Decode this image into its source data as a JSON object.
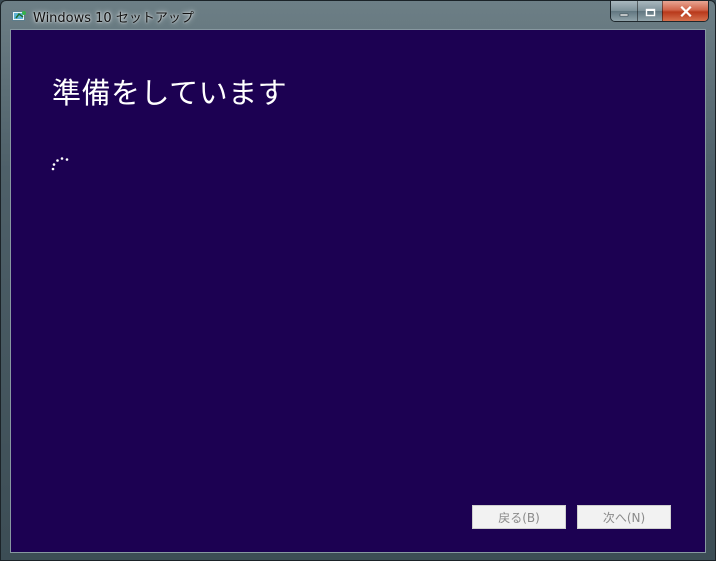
{
  "window": {
    "title": "Windows 10 セットアップ",
    "icon": "setup-app-icon",
    "caption_buttons": [
      "minimize-icon",
      "maximize-icon",
      "close-icon"
    ]
  },
  "main": {
    "heading": "準備をしています",
    "status_indicator": "loading-spinner-icon"
  },
  "footer": {
    "back_label": "戻る(B)",
    "next_label": "次へ(N)"
  },
  "colors": {
    "content_background": "#1c0152",
    "heading_text": "#ffffff",
    "disabled_button_text": "#8a8a8a"
  }
}
